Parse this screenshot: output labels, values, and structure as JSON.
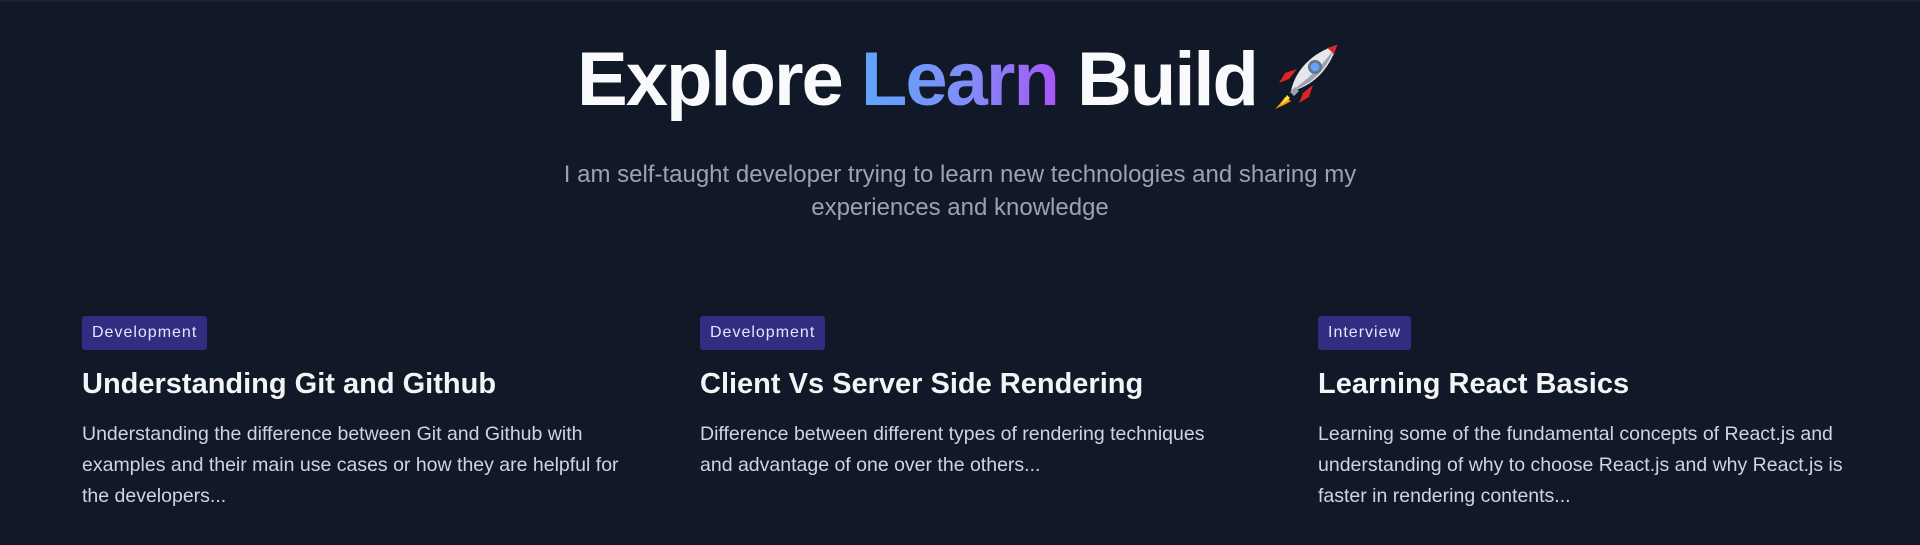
{
  "hero": {
    "title_part1": "Explore ",
    "title_highlight": "Learn",
    "title_part2": " Build",
    "subtitle": "I am self-taught developer trying to learn new technologies and sharing my experiences and knowledge",
    "icon": "rocket-icon"
  },
  "colors": {
    "background": "#111827",
    "gradient_start": "#60a5fa",
    "gradient_end": "#a855f7",
    "badge_bg": "#312e81"
  },
  "posts": [
    {
      "category": "Development",
      "title": "Understanding Git and Github",
      "description": "Understanding the difference between Git and Github with examples and their main use cases or how they are helpful for the developers..."
    },
    {
      "category": "Development",
      "title": "Client Vs Server Side Rendering",
      "description": "Difference between different types of rendering techniques and advantage of one over the others..."
    },
    {
      "category": "Interview",
      "title": "Learning React Basics",
      "description": "Learning some of the fundamental concepts of React.js and understanding of why to choose React.js and why React.js is faster in rendering contents..."
    }
  ]
}
